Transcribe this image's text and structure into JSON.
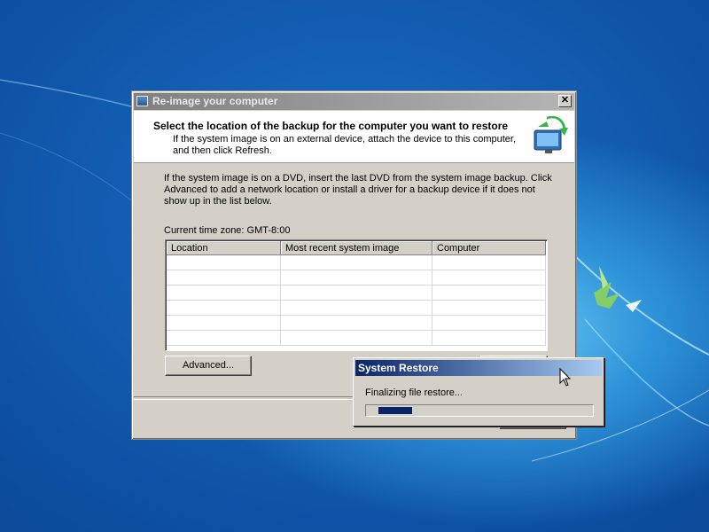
{
  "dialog": {
    "title": "Re-image your computer",
    "header_title": "Select the location of the backup for the computer you want to restore",
    "header_subtitle": "If the system image is on an external device, attach the device to this computer, and then click Refresh.",
    "body_text": "If the system image is on a DVD, insert the last DVD from the system image backup. Click Advanced to add a network location or install a driver for a backup device if it does not show up in the list below.",
    "timezone": "Current time zone: GMT-8:00",
    "table": {
      "columns": [
        "Location",
        "Most recent system image",
        "Computer"
      ],
      "rows": []
    },
    "advanced_label": "Advanced...",
    "close_glyph": "✕"
  },
  "system_restore": {
    "title": "System Restore",
    "message": "Finalizing file restore...",
    "progress": 0.16
  },
  "colors": {
    "desktop": "#1565c0",
    "popup_title": "#0a246a",
    "progress_fill": "#0a246a"
  },
  "icons": [
    "app-icon",
    "computer-restore-icon",
    "close-icon",
    "mouse-cursor-icon"
  ]
}
